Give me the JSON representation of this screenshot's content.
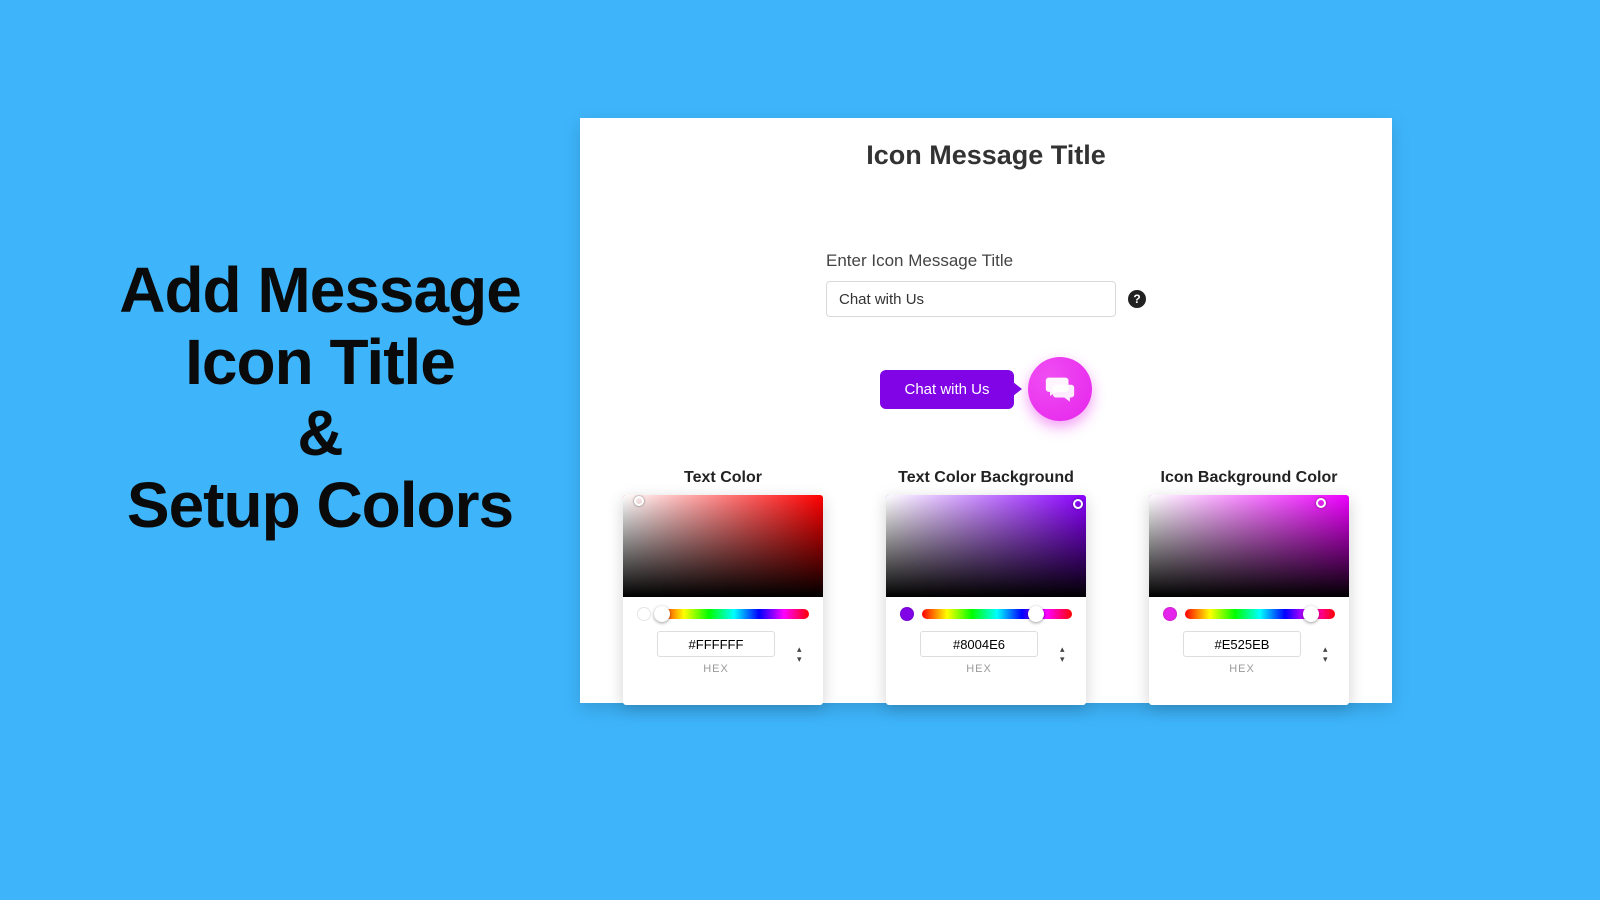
{
  "left": {
    "line1": "Add Message",
    "line2": "Icon Title",
    "line3": "&",
    "line4": "Setup Colors"
  },
  "panel": {
    "title": "Icon Message Title",
    "field_label": "Enter Icon Message Title",
    "input_value": "Chat with Us",
    "preview_label": "Chat with Us"
  },
  "pickers": {
    "text_color": {
      "title": "Text Color",
      "hex": "#FFFFFF",
      "mode": "HEX",
      "base": "#ff0000",
      "chip": "#ffffff",
      "hue_pos": "2%",
      "thumb_x": "8%",
      "thumb_y": "6%"
    },
    "text_bg": {
      "title": "Text Color Background",
      "hex": "#8004E6",
      "mode": "HEX",
      "base": "#8a00ff",
      "chip": "#8004E6",
      "hue_pos": "76%",
      "thumb_x": "96%",
      "thumb_y": "9%"
    },
    "icon_bg": {
      "title": "Icon Background Color",
      "hex": "#E525EB",
      "mode": "HEX",
      "base": "#ee00ff",
      "chip": "#E525EB",
      "hue_pos": "84%",
      "thumb_x": "86%",
      "thumb_y": "8%"
    }
  }
}
